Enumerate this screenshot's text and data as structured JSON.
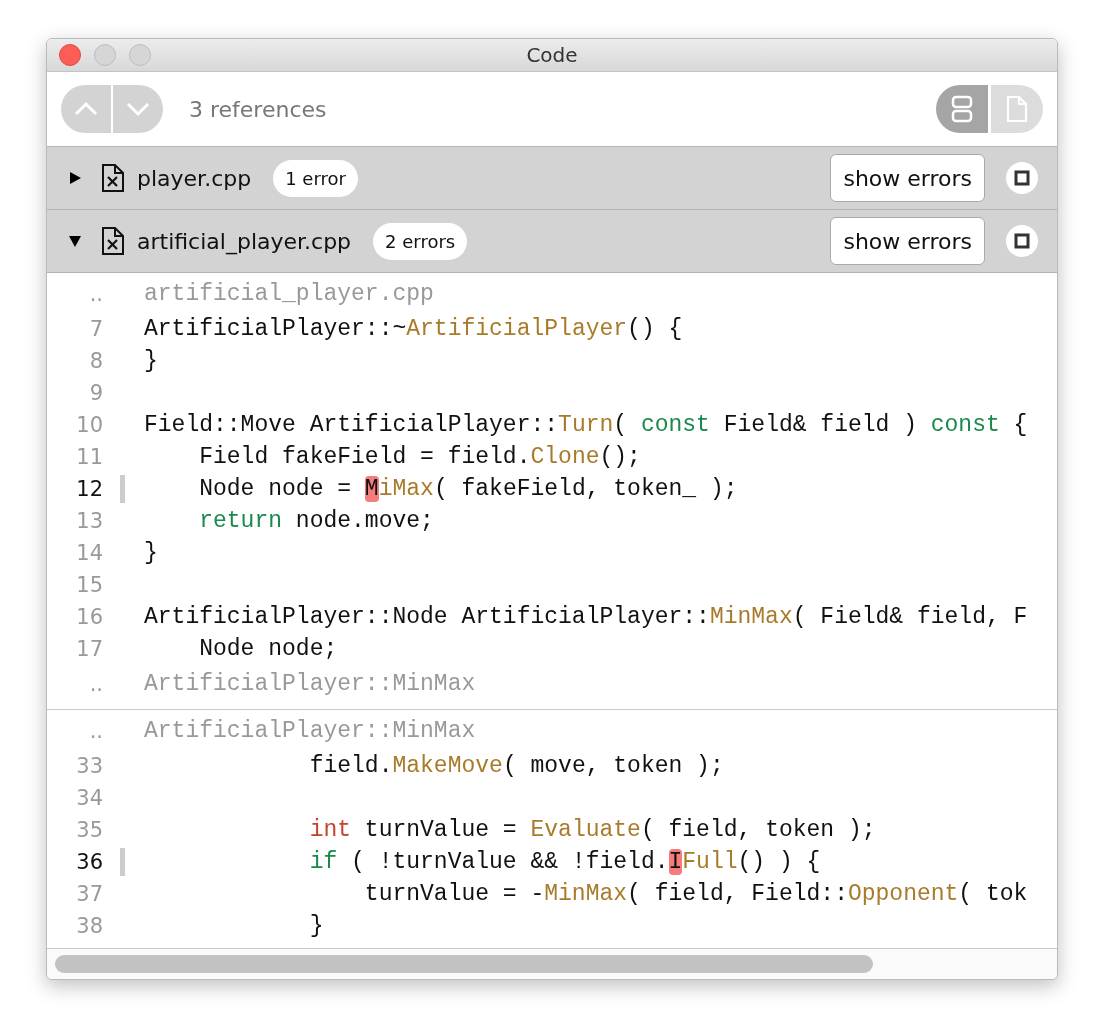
{
  "window": {
    "title": "Code"
  },
  "toolbar": {
    "nav_buttons": [
      {
        "kind": "up"
      },
      {
        "kind": "down"
      }
    ],
    "summary": "3 references",
    "view_modes": [
      {
        "kind": "split",
        "selected": true
      },
      {
        "kind": "file",
        "selected": false
      }
    ]
  },
  "files": [
    {
      "name": "player.cpp",
      "expanded": false,
      "badge": "1 error",
      "button": "show errors"
    },
    {
      "name": "artificial_player.cpp",
      "expanded": true,
      "badge": "2 errors",
      "button": "show errors"
    }
  ],
  "code_blocks": [
    {
      "header": {
        "marker": "..",
        "text": "artificial_player.cpp"
      },
      "lines": [
        {
          "number": "7",
          "current": false,
          "tokens": [
            {
              "kind": "plain",
              "text": "ArtificialPlayer::~"
            },
            {
              "kind": "fn",
              "text": "ArtificialPlayer"
            },
            {
              "kind": "plain",
              "text": "() {"
            }
          ]
        },
        {
          "number": "8",
          "current": false,
          "tokens": [
            {
              "kind": "plain",
              "text": "}"
            }
          ]
        },
        {
          "number": "9",
          "current": false
        },
        {
          "number": "10",
          "current": false,
          "tokens": [
            {
              "kind": "plain",
              "text": "Field::Move ArtificialPlayer::"
            },
            {
              "kind": "fn",
              "text": "Turn"
            },
            {
              "kind": "plain",
              "text": "( "
            },
            {
              "kind": "kw",
              "text": "const"
            },
            {
              "kind": "plain",
              "text": " Field& field ) "
            },
            {
              "kind": "kw",
              "text": "const"
            },
            {
              "kind": "plain",
              "text": " {"
            }
          ]
        },
        {
          "number": "11",
          "current": false,
          "tokens": [
            {
              "kind": "plain",
              "text": "    Field fakeField = field."
            },
            {
              "kind": "fn",
              "text": "Clone"
            },
            {
              "kind": "plain",
              "text": "();"
            }
          ]
        },
        {
          "number": "12",
          "current": true,
          "tokens": [
            {
              "kind": "plain",
              "text": "    Node node = "
            },
            {
              "kind": "error",
              "text": "M"
            },
            {
              "kind": "fn",
              "text": "iMax"
            },
            {
              "kind": "plain",
              "text": "( fakeField, token_ );"
            }
          ]
        },
        {
          "number": "13",
          "current": false,
          "tokens": [
            {
              "kind": "kw",
              "text": "    return"
            },
            {
              "kind": "plain",
              "text": " node.move;"
            }
          ]
        },
        {
          "number": "14",
          "current": false,
          "tokens": [
            {
              "kind": "plain",
              "text": "}"
            }
          ]
        },
        {
          "number": "15",
          "current": false
        },
        {
          "number": "16",
          "current": false,
          "tokens": [
            {
              "kind": "plain",
              "text": "ArtificialPlayer::Node ArtificialPlayer::"
            },
            {
              "kind": "fn",
              "text": "MinMax"
            },
            {
              "kind": "plain",
              "text": "( Field& field, F"
            }
          ]
        },
        {
          "number": "17",
          "current": false,
          "tokens": [
            {
              "kind": "plain",
              "text": "    Node node;"
            }
          ]
        }
      ],
      "footer": {
        "marker": "..",
        "text": "ArtificialPlayer::MinMax"
      }
    },
    {
      "header": {
        "marker": "..",
        "text": "ArtificialPlayer::MinMax"
      },
      "lines": [
        {
          "number": "33",
          "current": false,
          "tokens": [
            {
              "kind": "plain",
              "text": "            field."
            },
            {
              "kind": "fn",
              "text": "MakeMove"
            },
            {
              "kind": "plain",
              "text": "( move, token );"
            }
          ]
        },
        {
          "number": "34",
          "current": false
        },
        {
          "number": "35",
          "current": false,
          "tokens": [
            {
              "kind": "type",
              "text": "            int"
            },
            {
              "kind": "plain",
              "text": " turnValue = "
            },
            {
              "kind": "fn",
              "text": "Evaluate"
            },
            {
              "kind": "plain",
              "text": "( field, token );"
            }
          ]
        },
        {
          "number": "36",
          "current": true,
          "tokens": [
            {
              "kind": "kw",
              "text": "            if"
            },
            {
              "kind": "plain",
              "text": " ( !turnValue && !field."
            },
            {
              "kind": "error",
              "text": "I"
            },
            {
              "kind": "fn",
              "text": "Full"
            },
            {
              "kind": "plain",
              "text": "() ) {"
            }
          ]
        },
        {
          "number": "37",
          "current": false,
          "tokens": [
            {
              "kind": "plain",
              "text": "                turnValue = -"
            },
            {
              "kind": "fn",
              "text": "MinMax"
            },
            {
              "kind": "plain",
              "text": "( field, Field::"
            },
            {
              "kind": "fn",
              "text": "Opponent"
            },
            {
              "kind": "plain",
              "text": "( tok"
            }
          ]
        },
        {
          "number": "38",
          "current": false,
          "tokens": [
            {
              "kind": "plain",
              "text": "            }"
            }
          ]
        }
      ]
    }
  ]
}
